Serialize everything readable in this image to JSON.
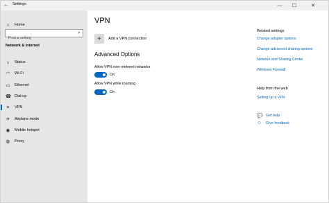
{
  "window": {
    "title": "Settings"
  },
  "sidebar": {
    "home": "Home",
    "search_placeholder": "Find a setting",
    "section": "Network & Internet",
    "items": [
      {
        "label": "Status",
        "icon": "status-icon"
      },
      {
        "label": "Wi-Fi",
        "icon": "wifi-icon"
      },
      {
        "label": "Ethernet",
        "icon": "ethernet-icon"
      },
      {
        "label": "Dial-up",
        "icon": "dialup-icon"
      },
      {
        "label": "VPN",
        "icon": "vpn-icon",
        "active": true
      },
      {
        "label": "Airplane mode",
        "icon": "airplane-icon"
      },
      {
        "label": "Mobile hotspot",
        "icon": "hotspot-icon"
      },
      {
        "label": "Proxy",
        "icon": "globe-icon"
      }
    ]
  },
  "main": {
    "title": "VPN",
    "add_vpn": "Add a VPN connection",
    "advanced_title": "Advanced Options",
    "options": [
      {
        "label": "Allow VPN over metered networks",
        "state": "On"
      },
      {
        "label": "Allow VPN while roaming",
        "state": "On"
      }
    ]
  },
  "related": {
    "heading": "Related settings",
    "links": [
      "Change adapter options",
      "Change advanced sharing options",
      "Network and Sharing Center",
      "Windows Firewall"
    ],
    "help_heading": "Help from the web",
    "help_link": "Setting up a VPN",
    "get_help": "Get help",
    "feedback": "Give feedback"
  },
  "colors": {
    "accent": "#0067c0",
    "sidebar": "#e6e6e6",
    "titlebar": "#f0f0f0"
  }
}
